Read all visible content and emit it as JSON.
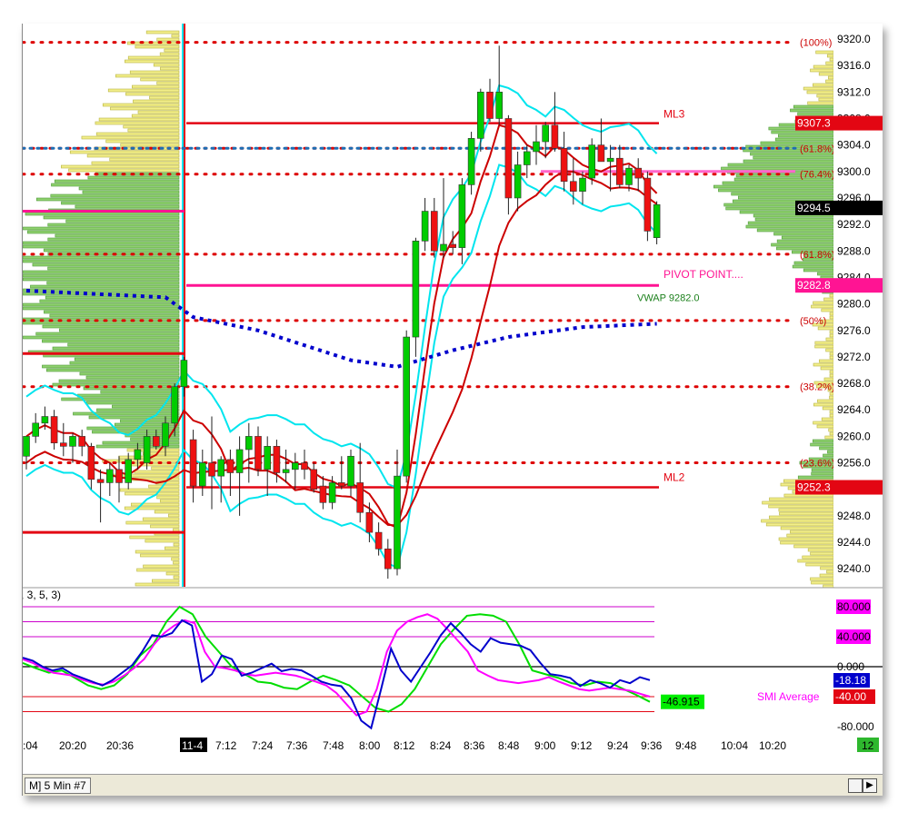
{
  "price_axis": {
    "ticks": [
      "9320.0",
      "9316.0",
      "9312.0",
      "9308.0",
      "9304.0",
      "9300.0",
      "9296.0",
      "9292.0",
      "9288.0",
      "9284.0",
      "9280.0",
      "9276.0",
      "9272.0",
      "9268.0",
      "9264.0",
      "9260.0",
      "9256.0",
      "9252.0",
      "9248.0",
      "9244.0",
      "9240.0"
    ],
    "range": [
      9238.5,
      9322.0
    ]
  },
  "price_badges": [
    {
      "label": "9307.3",
      "value": 9307.3,
      "bg": "#e30613",
      "fg": "#ffffff"
    },
    {
      "label": "9294.5",
      "value": 9294.5,
      "bg": "#000000",
      "fg": "#ffffff"
    },
    {
      "label": "9282.8",
      "value": 9282.8,
      "bg": "#ff1493",
      "fg": "#ffffff"
    },
    {
      "label": "9252.3",
      "value": 9252.3,
      "bg": "#e30613",
      "fg": "#ffffff"
    }
  ],
  "fib_labels": [
    {
      "label": "(100%)",
      "value": 9319.5
    },
    {
      "label": "(61.8%)",
      "value": 9303.5
    },
    {
      "label": "(76.4%)",
      "value": 9299.6
    },
    {
      "label": "(61.8%)",
      "value": 9287.5
    },
    {
      "label": "(50%)",
      "value": 9277.5
    },
    {
      "label": "(38.2%)",
      "value": 9267.5
    },
    {
      "label": "(23.6%)",
      "value": 9256.0
    }
  ],
  "level_labels": {
    "ml3": "ML3",
    "pivot": "PIVOT POINT....",
    "vwap": "VWAP 9282.0",
    "ml2": "ML2"
  },
  "time_axis": {
    "labels": [
      ":04",
      "20:20",
      "20:36",
      "11-4",
      "7:12",
      "7:24",
      "7:36",
      "7:48",
      "8:00",
      "8:12",
      "8:24",
      "8:36",
      "8:48",
      "9:00",
      "9:12",
      "9:24",
      "9:36",
      "9:48",
      "10:04",
      "10:20"
    ],
    "highlight": "11-4"
  },
  "indicator": {
    "title_fragment": ", 3, 5, 3)",
    "axis_ticks": [
      {
        "label": "80.000",
        "value": 80,
        "badge": true,
        "bg": "#ff00ff",
        "fg": "#000000"
      },
      {
        "label": "40.000",
        "value": 40,
        "badge": true,
        "bg": "#ff00ff",
        "fg": "#000000"
      },
      {
        "label": "0.000",
        "value": 0,
        "badge": false
      },
      {
        "label": "-80.000",
        "value": -80,
        "badge": false
      }
    ],
    "badges": [
      {
        "label": "-18.18",
        "value": -18.18,
        "bg": "#0000cc",
        "fg": "#ffffff"
      },
      {
        "label": "-40.00",
        "value": -40,
        "bg": "#e30613",
        "fg": "#ffffff"
      },
      {
        "label": "-46.915",
        "value": -46.9,
        "bg": "#00ee00",
        "fg": "#000000"
      }
    ],
    "legend": "SMI Average",
    "range": [
      -86,
      92
    ]
  },
  "bottom_tab": "M]  5 Min   #7",
  "page_counter": "12",
  "colors": {
    "up_candle": "#00cc00",
    "down_candle": "#ee1111",
    "bollinger": "#00e5ee",
    "vwap": "#0000cc",
    "fib": "#dd0000",
    "pivot": "#ff1493",
    "smi": "#0000cc",
    "smi_avg": "#ff00ff",
    "smi_signal": "#00dd00"
  },
  "chart_data": {
    "type": "candlestick",
    "price_candles": [
      {
        "o": 9257.0,
        "h": 9260.0,
        "l": 9255.0,
        "c": 9260.0
      },
      {
        "o": 9260.0,
        "h": 9263.5,
        "l": 9259.0,
        "c": 9262.0
      },
      {
        "o": 9262.0,
        "h": 9264.5,
        "l": 9261.0,
        "c": 9263.0
      },
      {
        "o": 9263.0,
        "h": 9264.0,
        "l": 9258.0,
        "c": 9259.0
      },
      {
        "o": 9259.0,
        "h": 9262.0,
        "l": 9257.0,
        "c": 9258.5
      },
      {
        "o": 9258.5,
        "h": 9260.5,
        "l": 9256.0,
        "c": 9260.0
      },
      {
        "o": 9260.0,
        "h": 9261.0,
        "l": 9257.0,
        "c": 9258.5
      },
      {
        "o": 9258.5,
        "h": 9259.0,
        "l": 9252.0,
        "c": 9253.5
      },
      {
        "o": 9253.5,
        "h": 9255.0,
        "l": 9247.0,
        "c": 9253.0
      },
      {
        "o": 9253.0,
        "h": 9256.0,
        "l": 9251.0,
        "c": 9255.0
      },
      {
        "o": 9255.0,
        "h": 9257.0,
        "l": 9250.0,
        "c": 9253.0
      },
      {
        "o": 9253.0,
        "h": 9257.5,
        "l": 9252.0,
        "c": 9256.5
      },
      {
        "o": 9256.5,
        "h": 9259.0,
        "l": 9255.0,
        "c": 9258.0
      },
      {
        "o": 9256.0,
        "h": 9261.0,
        "l": 9255.0,
        "c": 9260.0
      },
      {
        "o": 9260.0,
        "h": 9261.0,
        "l": 9258.0,
        "c": 9258.5
      },
      {
        "o": 9258.5,
        "h": 9263.0,
        "l": 9257.0,
        "c": 9262.0
      },
      {
        "o": 9262.0,
        "h": 9268.0,
        "l": 9260.0,
        "c": 9267.5
      },
      {
        "o": 9267.5,
        "h": 9272.0,
        "l": 9266.0,
        "c": 9271.5
      },
      {
        "o": 9259.5,
        "h": 9261.0,
        "l": 9250.0,
        "c": 9252.5
      },
      {
        "o": 9252.5,
        "h": 9258.0,
        "l": 9251.0,
        "c": 9256.0
      },
      {
        "o": 9256.0,
        "h": 9263.0,
        "l": 9249.0,
        "c": 9254.0
      },
      {
        "o": 9254.0,
        "h": 9257.0,
        "l": 9250.0,
        "c": 9256.5
      },
      {
        "o": 9256.5,
        "h": 9258.0,
        "l": 9251.0,
        "c": 9254.5
      },
      {
        "o": 9254.5,
        "h": 9260.0,
        "l": 9248.0,
        "c": 9258.0
      },
      {
        "o": 9258.0,
        "h": 9262.0,
        "l": 9253.0,
        "c": 9260.0
      },
      {
        "o": 9260.0,
        "h": 9261.5,
        "l": 9254.0,
        "c": 9255.0
      },
      {
        "o": 9255.0,
        "h": 9260.0,
        "l": 9251.0,
        "c": 9258.5
      },
      {
        "o": 9258.5,
        "h": 9259.5,
        "l": 9253.0,
        "c": 9254.5
      },
      {
        "o": 9254.5,
        "h": 9258.0,
        "l": 9253.0,
        "c": 9255.0
      },
      {
        "o": 9255.0,
        "h": 9257.5,
        "l": 9252.0,
        "c": 9256.0
      },
      {
        "o": 9256.0,
        "h": 9258.0,
        "l": 9253.5,
        "c": 9255.0
      },
      {
        "o": 9255.0,
        "h": 9256.0,
        "l": 9251.5,
        "c": 9252.0
      },
      {
        "o": 9252.5,
        "h": 9254.0,
        "l": 9249.0,
        "c": 9250.0
      },
      {
        "o": 9250.0,
        "h": 9254.0,
        "l": 9249.0,
        "c": 9253.0
      },
      {
        "o": 9253.0,
        "h": 9257.0,
        "l": 9252.0,
        "c": 9252.5
      },
      {
        "o": 9252.5,
        "h": 9258.0,
        "l": 9251.0,
        "c": 9257.0
      },
      {
        "o": 9253.0,
        "h": 9259.0,
        "l": 9247.0,
        "c": 9248.5
      },
      {
        "o": 9248.5,
        "h": 9250.0,
        "l": 9244.0,
        "c": 9245.5
      },
      {
        "o": 9245.5,
        "h": 9247.0,
        "l": 9242.0,
        "c": 9243.0
      },
      {
        "o": 9243.0,
        "h": 9244.5,
        "l": 9238.5,
        "c": 9240.0
      },
      {
        "o": 9240.0,
        "h": 9258.0,
        "l": 9239.0,
        "c": 9254.0
      },
      {
        "o": 9254.0,
        "h": 9276.0,
        "l": 9253.0,
        "c": 9275.0
      },
      {
        "o": 9275.0,
        "h": 9290.0,
        "l": 9272.0,
        "c": 9289.5
      },
      {
        "o": 9289.5,
        "h": 9296.0,
        "l": 9288.0,
        "c": 9294.0
      },
      {
        "o": 9294.0,
        "h": 9296.0,
        "l": 9287.0,
        "c": 9288.0
      },
      {
        "o": 9288.0,
        "h": 9299.0,
        "l": 9287.0,
        "c": 9289.0
      },
      {
        "o": 9289.0,
        "h": 9291.0,
        "l": 9287.5,
        "c": 9288.5
      },
      {
        "o": 9288.5,
        "h": 9299.0,
        "l": 9286.0,
        "c": 9298.0
      },
      {
        "o": 9298.0,
        "h": 9306.0,
        "l": 9296.5,
        "c": 9305.0
      },
      {
        "o": 9305.0,
        "h": 9312.5,
        "l": 9303.0,
        "c": 9312.0
      },
      {
        "o": 9312.0,
        "h": 9314.0,
        "l": 9307.5,
        "c": 9308.0
      },
      {
        "o": 9308.0,
        "h": 9319.0,
        "l": 9307.0,
        "c": 9312.0
      },
      {
        "o": 9308.0,
        "h": 9308.5,
        "l": 9293.5,
        "c": 9296.0
      },
      {
        "o": 9296.0,
        "h": 9303.0,
        "l": 9294.0,
        "c": 9301.0
      },
      {
        "o": 9301.0,
        "h": 9304.0,
        "l": 9299.0,
        "c": 9303.0
      },
      {
        "o": 9303.0,
        "h": 9307.0,
        "l": 9301.0,
        "c": 9304.5
      },
      {
        "o": 9304.5,
        "h": 9307.5,
        "l": 9302.0,
        "c": 9307.0
      },
      {
        "o": 9307.0,
        "h": 9312.0,
        "l": 9303.0,
        "c": 9303.5
      },
      {
        "o": 9303.5,
        "h": 9306.0,
        "l": 9297.0,
        "c": 9298.5
      },
      {
        "o": 9298.5,
        "h": 9302.0,
        "l": 9295.0,
        "c": 9297.0
      },
      {
        "o": 9297.0,
        "h": 9300.0,
        "l": 9295.0,
        "c": 9299.0
      },
      {
        "o": 9299.0,
        "h": 9305.0,
        "l": 9298.0,
        "c": 9304.0
      },
      {
        "o": 9304.0,
        "h": 9308.0,
        "l": 9302.0,
        "c": 9301.5
      },
      {
        "o": 9301.5,
        "h": 9304.0,
        "l": 9297.0,
        "c": 9302.0
      },
      {
        "o": 9302.0,
        "h": 9304.0,
        "l": 9297.5,
        "c": 9298.0
      },
      {
        "o": 9298.0,
        "h": 9301.0,
        "l": 9297.0,
        "c": 9300.5
      },
      {
        "o": 9300.5,
        "h": 9302.0,
        "l": 9297.0,
        "c": 9299.0
      },
      {
        "o": 9299.0,
        "h": 9300.0,
        "l": 9289.5,
        "c": 9291.0
      },
      {
        "o": 9290.0,
        "h": 9295.5,
        "l": 9289.0,
        "c": 9295.0
      }
    ],
    "levels": {
      "ml3": 9307.3,
      "pivot": 9282.8,
      "ml2": 9252.3,
      "fib": [
        9319.5,
        9303.5,
        9299.6,
        9287.5,
        9277.5,
        9267.5,
        9256.0
      ]
    },
    "vwap": [
      {
        "t": 0,
        "v": 9282.0
      },
      {
        "t": 15,
        "v": 9281.0
      },
      {
        "t": 18,
        "v": 9278.0
      },
      {
        "t": 25,
        "v": 9276.0
      },
      {
        "t": 35,
        "v": 9271.5
      },
      {
        "t": 40,
        "v": 9270.5
      },
      {
        "t": 46,
        "v": 9273.0
      },
      {
        "t": 52,
        "v": 9275.0
      },
      {
        "t": 60,
        "v": 9276.5
      },
      {
        "t": 68,
        "v": 9277.0
      }
    ],
    "smi": [
      12,
      8,
      0,
      -5,
      -2,
      -10,
      -15,
      -20,
      -25,
      -18,
      -8,
      2,
      20,
      42,
      40,
      45,
      62,
      55,
      -20,
      -10,
      15,
      10,
      -12,
      -8,
      -2,
      4,
      -6,
      -3,
      -5,
      -12,
      -20,
      -24,
      -26,
      -42,
      -72,
      -82,
      -30,
      24,
      -5,
      -20,
      0,
      20,
      42,
      58,
      45,
      30,
      20,
      38,
      32,
      30,
      28,
      22,
      5,
      -10,
      -12,
      -15,
      -26,
      -18,
      -22,
      -28,
      -18,
      -22,
      -14,
      -18
    ],
    "smi_avg": [
      10,
      5,
      -2,
      -8,
      -10,
      -12,
      -18,
      -22,
      -24,
      -20,
      -12,
      -2,
      10,
      30,
      45,
      55,
      62,
      58,
      20,
      0,
      -2,
      -5,
      -10,
      -12,
      -10,
      -8,
      -10,
      -12,
      -16,
      -20,
      -25,
      -35,
      -50,
      -65,
      -60,
      -30,
      20,
      48,
      60,
      66,
      70,
      64,
      50,
      35,
      20,
      -5,
      -12,
      -18,
      -20,
      -22,
      -20,
      -18,
      -14,
      -20,
      -25,
      -30,
      -32,
      -30,
      -28,
      -30,
      -32,
      -36,
      -40
    ],
    "smi_signal": [
      5,
      -2,
      -8,
      -5,
      -15,
      -25,
      -30,
      -25,
      -10,
      15,
      30,
      60,
      80,
      70,
      40,
      20,
      0,
      -10,
      -20,
      -22,
      -28,
      -30,
      -20,
      -12,
      -18,
      -25,
      -40,
      -55,
      -60,
      -50,
      -30,
      0,
      30,
      50,
      68,
      70,
      68,
      60,
      30,
      -5,
      -10,
      -15,
      -22,
      -25,
      -20,
      -22,
      -30,
      -38,
      -46.9
    ]
  }
}
